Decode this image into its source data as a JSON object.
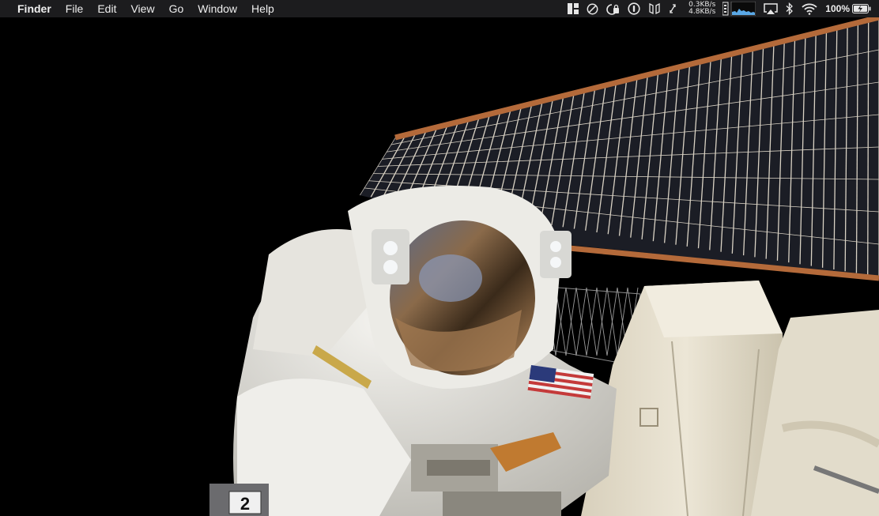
{
  "menubar": {
    "app_name": "Finder",
    "menus": [
      "File",
      "Edit",
      "View",
      "Go",
      "Window",
      "Help"
    ],
    "network": {
      "upload": "0.3KB/s",
      "download": "4.8KB/s"
    },
    "battery_percent": "100%",
    "tray_icons": [
      "magnet-icon",
      "do-not-disturb-icon",
      "lock-clock-icon",
      "info-icon",
      "bracket-icon",
      "resize-icon",
      "cpu-graph-icon",
      "airplay-icon",
      "bluetooth-icon",
      "wifi-icon",
      "battery-charging-icon"
    ]
  },
  "wallpaper": {
    "subject": "astronaut-spacewalk",
    "badge_number": "2",
    "colors": {
      "space": "#000000",
      "suit": "#e8e6e0",
      "panel_frame": "#b07040",
      "panel_cell": "#1a1c24"
    }
  }
}
